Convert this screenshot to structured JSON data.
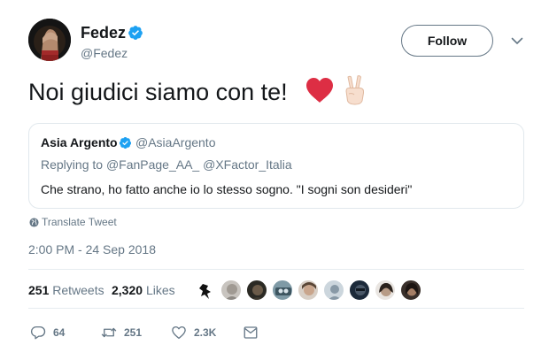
{
  "author": {
    "name": "Fedez",
    "handle": "@Fedez"
  },
  "follow_label": "Follow",
  "tweet": {
    "text": "Noi giudici siamo con te!"
  },
  "quoted": {
    "name": "Asia Argento",
    "handle": "@AsiaArgento",
    "replying_label": "Replying to",
    "replying_to": [
      "@FanPage_AA_",
      "@XFactor_Italia"
    ],
    "text": "Che strano, ho fatto anche io lo stesso sogno. \"I sogni son desideri\""
  },
  "translate_label": "Translate Tweet",
  "timestamp": "2:00 PM - 24 Sep 2018",
  "stats": {
    "retweets_count": "251",
    "retweets_label": "Retweets",
    "likes_count": "2,320",
    "likes_label": "Likes"
  },
  "actions": {
    "replies": "64",
    "retweets": "251",
    "likes": "2.3K"
  },
  "colors": {
    "verified": "#1da1f2",
    "secondary_text": "#657786",
    "heart": "#dd2e44"
  },
  "icons": [
    "verified-icon",
    "chevron-down-icon",
    "heart-emoji",
    "victory-hand-emoji",
    "globe-icon",
    "reply-icon",
    "retweet-icon",
    "like-icon",
    "message-icon"
  ]
}
